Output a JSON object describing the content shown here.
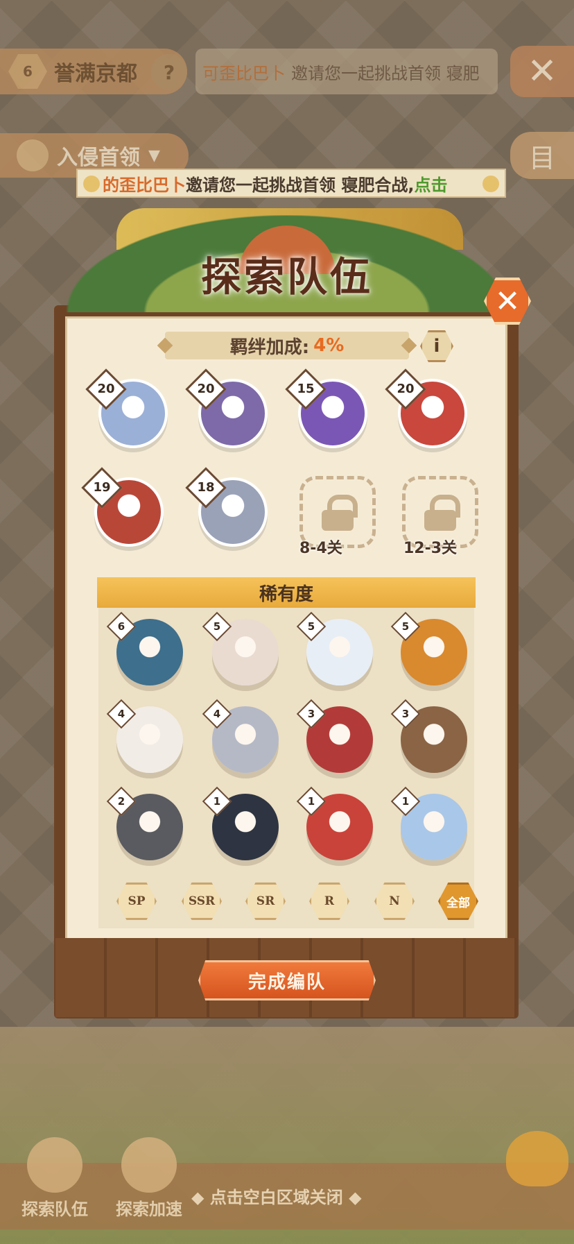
{
  "top": {
    "level": "6",
    "area_name": "誉满京都",
    "help": "?",
    "marquee_name": "可歪比巴卜",
    "marquee_text": "邀请您一起挑战首领 寝肥",
    "close": "✕"
  },
  "invade": {
    "label": "入侵首领",
    "caret": "▼"
  },
  "side_icon": "目",
  "banner": {
    "name": "的歪比巴卜",
    "text": "邀请您一起挑战首领 寝肥合战,",
    "link": "点击"
  },
  "panel": {
    "title": "探索队伍",
    "close": "✕",
    "bond_label": "羁绊加成:",
    "bond_value": "4%",
    "info": "i",
    "team": [
      {
        "level": "20",
        "color": "#9bb0d6"
      },
      {
        "level": "20",
        "color": "#7e6aa8"
      },
      {
        "level": "15",
        "color": "#7b57b5"
      },
      {
        "level": "20",
        "color": "#c9473d"
      },
      {
        "level": "19",
        "color": "#b94738"
      },
      {
        "level": "18",
        "color": "#9aa2b8"
      }
    ],
    "locked": [
      {
        "label": "8-4关"
      },
      {
        "label": "12-3关"
      }
    ],
    "rarity_title": "稀有度",
    "shikigami": [
      {
        "count": "6",
        "color": "#3e6f8c"
      },
      {
        "count": "5",
        "color": "#e9dbd0"
      },
      {
        "count": "5",
        "color": "#e7eef6"
      },
      {
        "count": "5",
        "color": "#d9892e"
      },
      {
        "count": "4",
        "color": "#f2ece6"
      },
      {
        "count": "4",
        "color": "#b5b9c6"
      },
      {
        "count": "3",
        "color": "#b23b39"
      },
      {
        "count": "3",
        "color": "#8a6445"
      },
      {
        "count": "2",
        "color": "#5a5b60"
      },
      {
        "count": "1",
        "color": "#2e3441"
      },
      {
        "count": "1",
        "color": "#c9433a"
      },
      {
        "count": "1",
        "color": "#a9c7e8"
      }
    ],
    "filters": [
      "SP",
      "SSR",
      "SR",
      "R",
      "N",
      "全部"
    ],
    "active_filter": "全部",
    "confirm": "完成编队"
  },
  "bottom": {
    "tab1": "探索队伍",
    "tab2": "探索加速",
    "hint": "◆ 点击空白区域关闭 ◆"
  }
}
